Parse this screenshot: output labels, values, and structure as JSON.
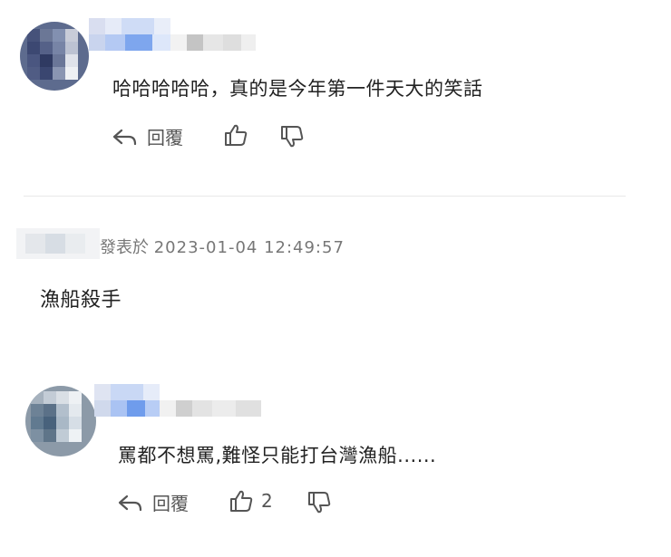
{
  "comments": [
    {
      "text": "哈哈哈哈哈，真的是今年第一件天大的笑話",
      "reply_label": "回覆",
      "like_count": "",
      "icons": {
        "reply": "reply-arrow-icon",
        "like": "thumbs-up-icon",
        "dislike": "thumbs-down-icon"
      }
    },
    {
      "posted_label": "發表於",
      "timestamp": "2023-01-04 12:49:57",
      "text": "漁船殺手"
    },
    {
      "text": "罵都不想罵,難怪只能打台灣漁船......",
      "reply_label": "回覆",
      "like_count": "2",
      "icons": {
        "reply": "reply-arrow-icon",
        "like": "thumbs-up-icon",
        "dislike": "thumbs-down-icon"
      }
    }
  ],
  "colors": {
    "text": "#222222",
    "muted": "#777777",
    "divider": "#e8e8e8",
    "icon": "#555555"
  }
}
